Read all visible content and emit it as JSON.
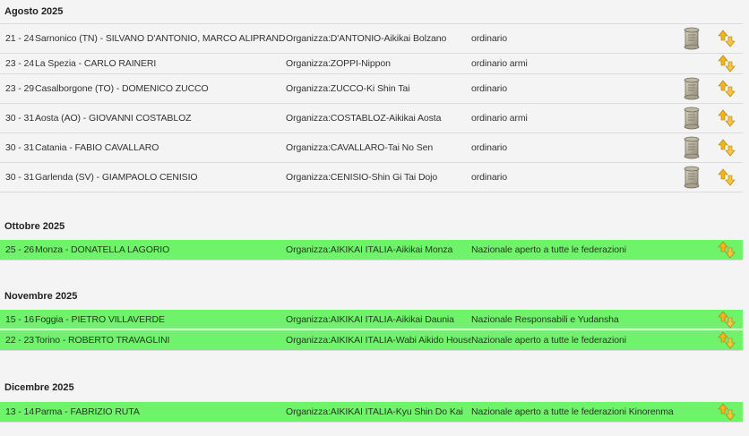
{
  "months": [
    {
      "title": "Agosto 2025",
      "rows": [
        {
          "date": "21 - 24",
          "place": "Sarnonico (TN) - SILVANO D'ANTONIO, MARCO ALIPRANDINI",
          "org": "Organizza:D'ANTONIO-Aikikai Bolzano",
          "type": "ordinario",
          "doc": true,
          "green": false
        },
        {
          "date": "23 - 24",
          "place": "La Spezia - CARLO RAINERI",
          "org": "Organizza:ZOPPI-Nippon",
          "type": "ordinario armi",
          "doc": false,
          "green": false
        },
        {
          "date": "23 - 29",
          "place": "Casalborgone (TO) - DOMENICO ZUCCO",
          "org": "Organizza:ZUCCO-Ki Shin Tai",
          "type": "ordinario",
          "doc": true,
          "green": false
        },
        {
          "date": "30 - 31",
          "place": "Aosta (AO) - GIOVANNI COSTABLOZ",
          "org": "Organizza:COSTABLOZ-Aikikai Aosta",
          "type": "ordinario armi",
          "doc": true,
          "green": false
        },
        {
          "date": "30 - 31",
          "place": "Catania - FABIO CAVALLARO",
          "org": "Organizza:CAVALLARO-Tai No Sen",
          "type": "ordinario",
          "doc": true,
          "green": false
        },
        {
          "date": "30 - 31",
          "place": "Garlenda (SV) - GIAMPAOLO CENISIO",
          "org": "Organizza:CENISIO-Shin Gi Tai Dojo",
          "type": "ordinario",
          "doc": true,
          "green": false
        }
      ]
    },
    {
      "title": "Ottobre 2025",
      "rows": [
        {
          "date": "25 - 26",
          "place": "Monza - DONATELLA LAGORIO",
          "org": "Organizza:AIKIKAI ITALIA-Aikikai Monza",
          "type": "Nazionale aperto a tutte le federazioni",
          "doc": false,
          "green": true
        }
      ]
    },
    {
      "title": "Novembre 2025",
      "rows": [
        {
          "date": "15 - 16",
          "place": "Foggia - PIETRO VILLAVERDE",
          "org": "Organizza:AIKIKAI ITALIA-Aikikai Daunia",
          "type": "Nazionale Responsabili e Yudansha",
          "doc": false,
          "green": true
        },
        {
          "date": "22 - 23",
          "place": "Torino - ROBERTO TRAVAGLINI",
          "org": "Organizza:AIKIKAI ITALIA-Wabi Aikido House",
          "type": "Nazionale aperto a tutte le federazioni",
          "doc": false,
          "green": true
        }
      ]
    },
    {
      "title": "Dicembre 2025",
      "rows": [
        {
          "date": "13 - 14",
          "place": "Parma - FABRIZIO RUTA",
          "org": "Organizza:AIKIKAI ITALIA-Kyu Shin Do Kai",
          "type": "Nazionale aperto a tutte le federazioni Kinorenma",
          "doc": false,
          "green": true
        }
      ]
    }
  ],
  "icons": {
    "doc": "scroll-document-icon",
    "action": "swap-arrows-icon"
  },
  "colors": {
    "green_row": "#6ff36a",
    "arrow_orange": "#f4b41a"
  }
}
